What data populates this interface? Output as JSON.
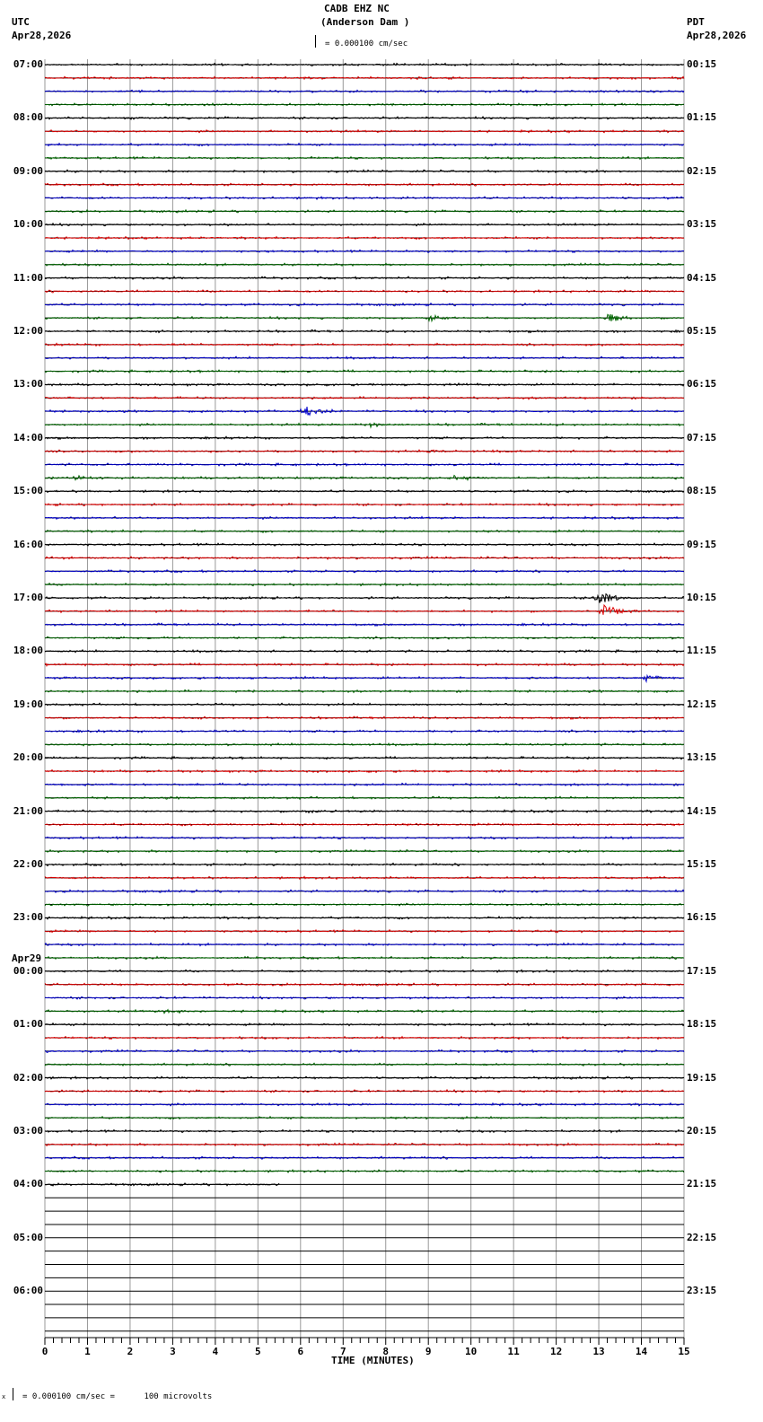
{
  "header": {
    "station": "CADB EHZ NC",
    "location": "(Anderson Dam )",
    "left_tz": "UTC",
    "left_date": "Apr28,2026",
    "right_tz": "PDT",
    "right_date": "Apr28,2026",
    "scale_text": "= 0.000100 cm/sec"
  },
  "footer": {
    "scale_text": "= 0.000100 cm/sec =      100 microvolts",
    "prefix": "x"
  },
  "chart_data": {
    "type": "line",
    "title": "CADB EHZ NC (Anderson Dam )",
    "xlabel": "TIME (MINUTES)",
    "xlim": [
      0,
      15
    ],
    "x_ticks": [
      "0",
      "1",
      "2",
      "3",
      "4",
      "5",
      "6",
      "7",
      "8",
      "9",
      "10",
      "11",
      "12",
      "13",
      "14",
      "15"
    ],
    "rows_total": 96,
    "rows_with_data": 84,
    "last_row_data_minutes": 5.5,
    "row_minutes": 15,
    "colors": [
      "#000000",
      "#dd0000",
      "#0000cc",
      "#006600"
    ],
    "left_labels": [
      "07:00",
      "08:00",
      "09:00",
      "10:00",
      "11:00",
      "12:00",
      "13:00",
      "14:00",
      "15:00",
      "16:00",
      "17:00",
      "18:00",
      "19:00",
      "20:00",
      "21:00",
      "22:00",
      "23:00",
      "00:00",
      "01:00",
      "02:00",
      "03:00",
      "04:00",
      "05:00",
      "06:00"
    ],
    "date_change_label": "Apr29",
    "right_labels": [
      "00:15",
      "01:15",
      "02:15",
      "03:15",
      "04:15",
      "05:15",
      "06:15",
      "07:15",
      "08:15",
      "09:15",
      "10:15",
      "11:15",
      "12:15",
      "13:15",
      "14:15",
      "15:15",
      "16:15",
      "17:15",
      "18:15",
      "19:15",
      "20:15",
      "21:15",
      "22:15",
      "23:15"
    ],
    "events": [
      {
        "row": 19,
        "minute": 9.0,
        "amp": 5
      },
      {
        "row": 19,
        "minute": 13.2,
        "amp": 6
      },
      {
        "row": 26,
        "minute": 6.1,
        "amp": 6
      },
      {
        "row": 27,
        "minute": 7.6,
        "amp": 3
      },
      {
        "row": 29,
        "minute": 9.0,
        "amp": 2
      },
      {
        "row": 31,
        "minute": 0.7,
        "amp": 3
      },
      {
        "row": 31,
        "minute": 9.6,
        "amp": 3
      },
      {
        "row": 40,
        "minute": 12.95,
        "amp": 9
      },
      {
        "row": 41,
        "minute": 13.1,
        "amp": 8
      },
      {
        "row": 46,
        "minute": 14.1,
        "amp": 4
      },
      {
        "row": 56,
        "minute": 6.1,
        "amp": 2
      },
      {
        "row": 71,
        "minute": 2.8,
        "amp": 2
      }
    ]
  }
}
